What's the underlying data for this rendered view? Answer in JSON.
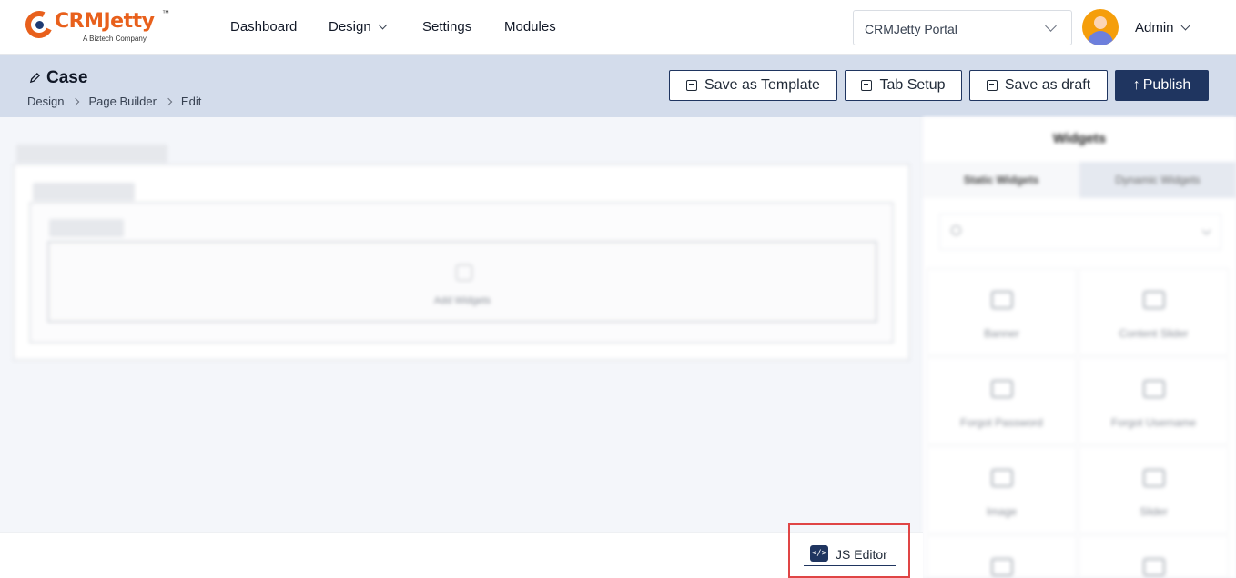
{
  "brand": {
    "name": "CRMJetty",
    "tm": "™",
    "tagline": "A Biztech Company",
    "accent": "#e8601c",
    "navy": "#1f3560"
  },
  "nav": {
    "items": [
      {
        "label": "Dashboard"
      },
      {
        "label": "Design",
        "dropdown": true
      },
      {
        "label": "Settings"
      },
      {
        "label": "Modules"
      }
    ]
  },
  "portal_select": {
    "value": "CRMJetty Portal"
  },
  "user": {
    "name": "Admin"
  },
  "page": {
    "title": "Case",
    "breadcrumb": [
      "Design",
      "Page Builder",
      "Edit"
    ]
  },
  "actions": {
    "save_template": "Save as Template",
    "tab_setup": "Tab Setup",
    "save_draft": "Save as draft",
    "publish": "Publish"
  },
  "canvas": {
    "drop_label": "Add Widgets"
  },
  "widgets": {
    "title": "Widgets",
    "tabs": [
      "Static Widgets",
      "Dynamic Widgets"
    ],
    "items": [
      "Banner",
      "Content Slider",
      "Forgot Password",
      "Forgot Username",
      "Image",
      "Slider"
    ]
  },
  "footer": {
    "js_editor": "JS Editor",
    "highlight_color": "#e04545"
  }
}
